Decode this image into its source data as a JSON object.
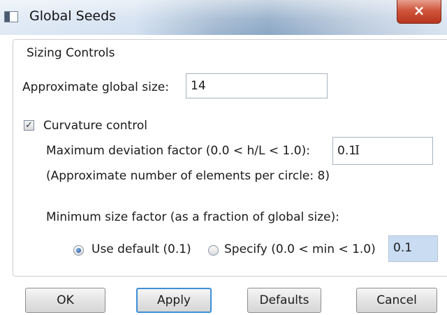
{
  "window": {
    "title": "Global Seeds",
    "close_glyph": "×"
  },
  "sizing": {
    "group_label": "Sizing Controls",
    "global_size_label": "Approximate global size:",
    "global_size_value": "14"
  },
  "curvature": {
    "checkbox_label": "Curvature control",
    "checked": true,
    "max_dev_label": "Maximum deviation factor (0.0 < h/L < 1.0):",
    "max_dev_value": "0.1",
    "elements_note": "(Approximate number of elements per circle: 8)"
  },
  "min_size": {
    "label": "Minimum size factor (as a fraction of global size):",
    "use_default_label": "Use default (0.1)",
    "specify_label": "Specify (0.0 < min < 1.0)",
    "specify_value": "0.1",
    "selected": "use_default"
  },
  "buttons": {
    "ok": "OK",
    "apply": "Apply",
    "defaults": "Defaults",
    "cancel": "Cancel"
  },
  "icons": [
    "app-icon",
    "close-icon",
    "checkbox-check-icon",
    "text-cursor-icon"
  ]
}
